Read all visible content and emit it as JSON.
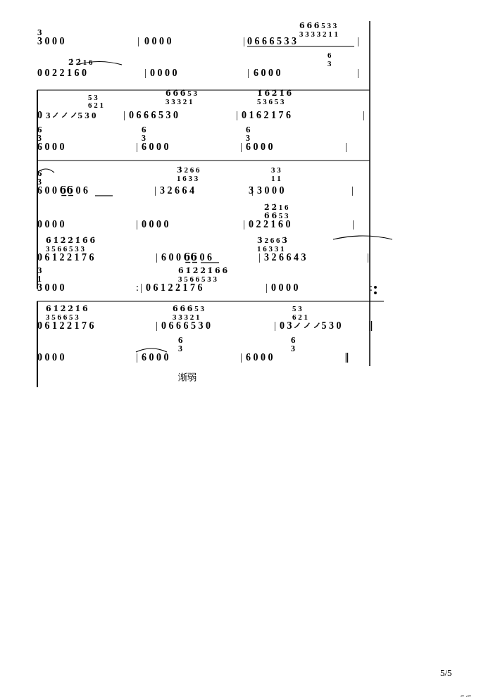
{
  "page": {
    "page_number": "5/5",
    "jianruo_label": "渐弱"
  },
  "score": {
    "description": "Numbered musical notation page 5 of 5"
  }
}
